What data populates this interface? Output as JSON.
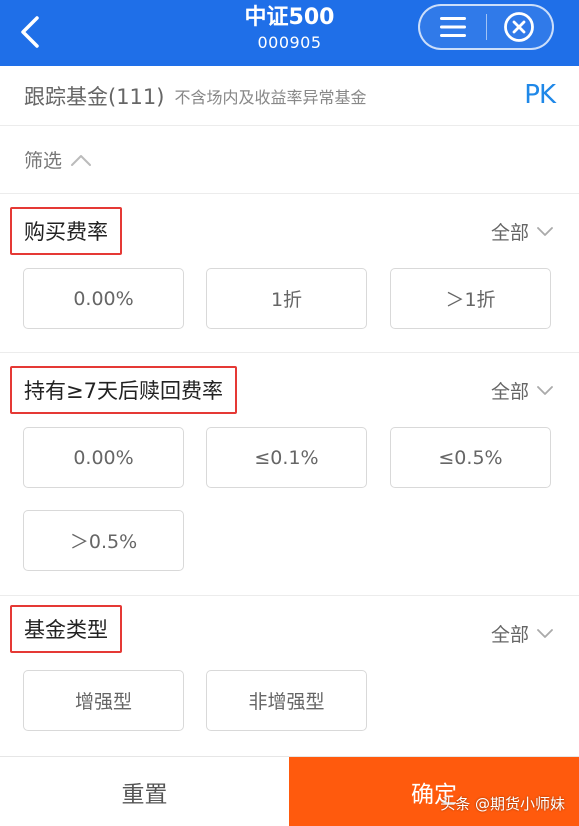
{
  "header": {
    "title": "中证500",
    "code": "000905"
  },
  "tracking": {
    "title": "跟踪基金(111)",
    "subtitle": "不含场内及收益率异常基金",
    "pk_label": "PK"
  },
  "filter": {
    "label": "筛选"
  },
  "sections": {
    "purchase_fee": {
      "title": "购买费率",
      "all_label": "全部",
      "options": [
        "0.00%",
        "1折",
        "＞1折"
      ]
    },
    "redemption_fee": {
      "title": "持有≥7天后赎回费率",
      "all_label": "全部",
      "options": [
        "0.00%",
        "≤0.1%",
        "≤0.5%",
        "＞0.5%"
      ]
    },
    "fund_type": {
      "title": "基金类型",
      "all_label": "全部",
      "options": [
        "增强型",
        "非增强型"
      ]
    }
  },
  "footer": {
    "reset_label": "重置",
    "confirm_label": "确定"
  },
  "watermark": "头条 @期货小师妹",
  "colors": {
    "header_bg": "#1f6fe8",
    "confirm_bg": "#ff5a0d",
    "highlight_border": "#e53935",
    "pk_color": "#1f88e8"
  }
}
